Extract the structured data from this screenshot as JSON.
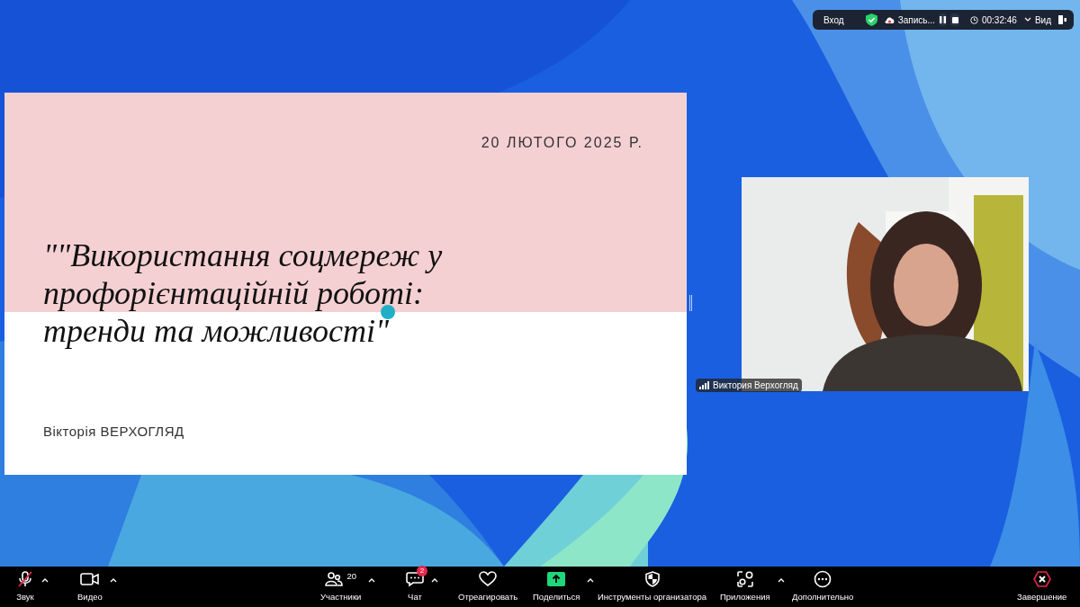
{
  "top_bar": {
    "view_label": "Вход",
    "recording_label": "Запись...",
    "timer": "00:32:46",
    "layout_label": "Вид",
    "secure": true
  },
  "slide": {
    "date": "20 ЛЮТОГО 2025 Р.",
    "title_lines": [
      "\"\"Використання соцмереж у",
      "профорієнтаційній роботі:",
      "тренди та можливості\""
    ],
    "author": "Вікторія ВЕРХОГЛЯД"
  },
  "video": {
    "participant_name": "Виктория Верхогляд"
  },
  "toolbar": [
    {
      "kind": "audio",
      "label": "Звук",
      "muted": true,
      "caret": true
    },
    {
      "kind": "video",
      "label": "Видео",
      "caret": true
    },
    {
      "kind": "participants",
      "label": "Участники",
      "count": "20",
      "caret": true
    },
    {
      "kind": "chat",
      "label": "Чат",
      "badge": "2",
      "caret": true
    },
    {
      "kind": "react",
      "label": "Отреагировать",
      "caret": false
    },
    {
      "kind": "share",
      "label": "Поделиться",
      "caret": true
    },
    {
      "kind": "host",
      "label": "Инструменты организатора",
      "caret": false
    },
    {
      "kind": "apps",
      "label": "Приложения",
      "caret": true
    },
    {
      "kind": "more",
      "label": "Дополнительно",
      "caret": false
    },
    {
      "kind": "end",
      "label": "Завершение",
      "caret": false
    }
  ]
}
